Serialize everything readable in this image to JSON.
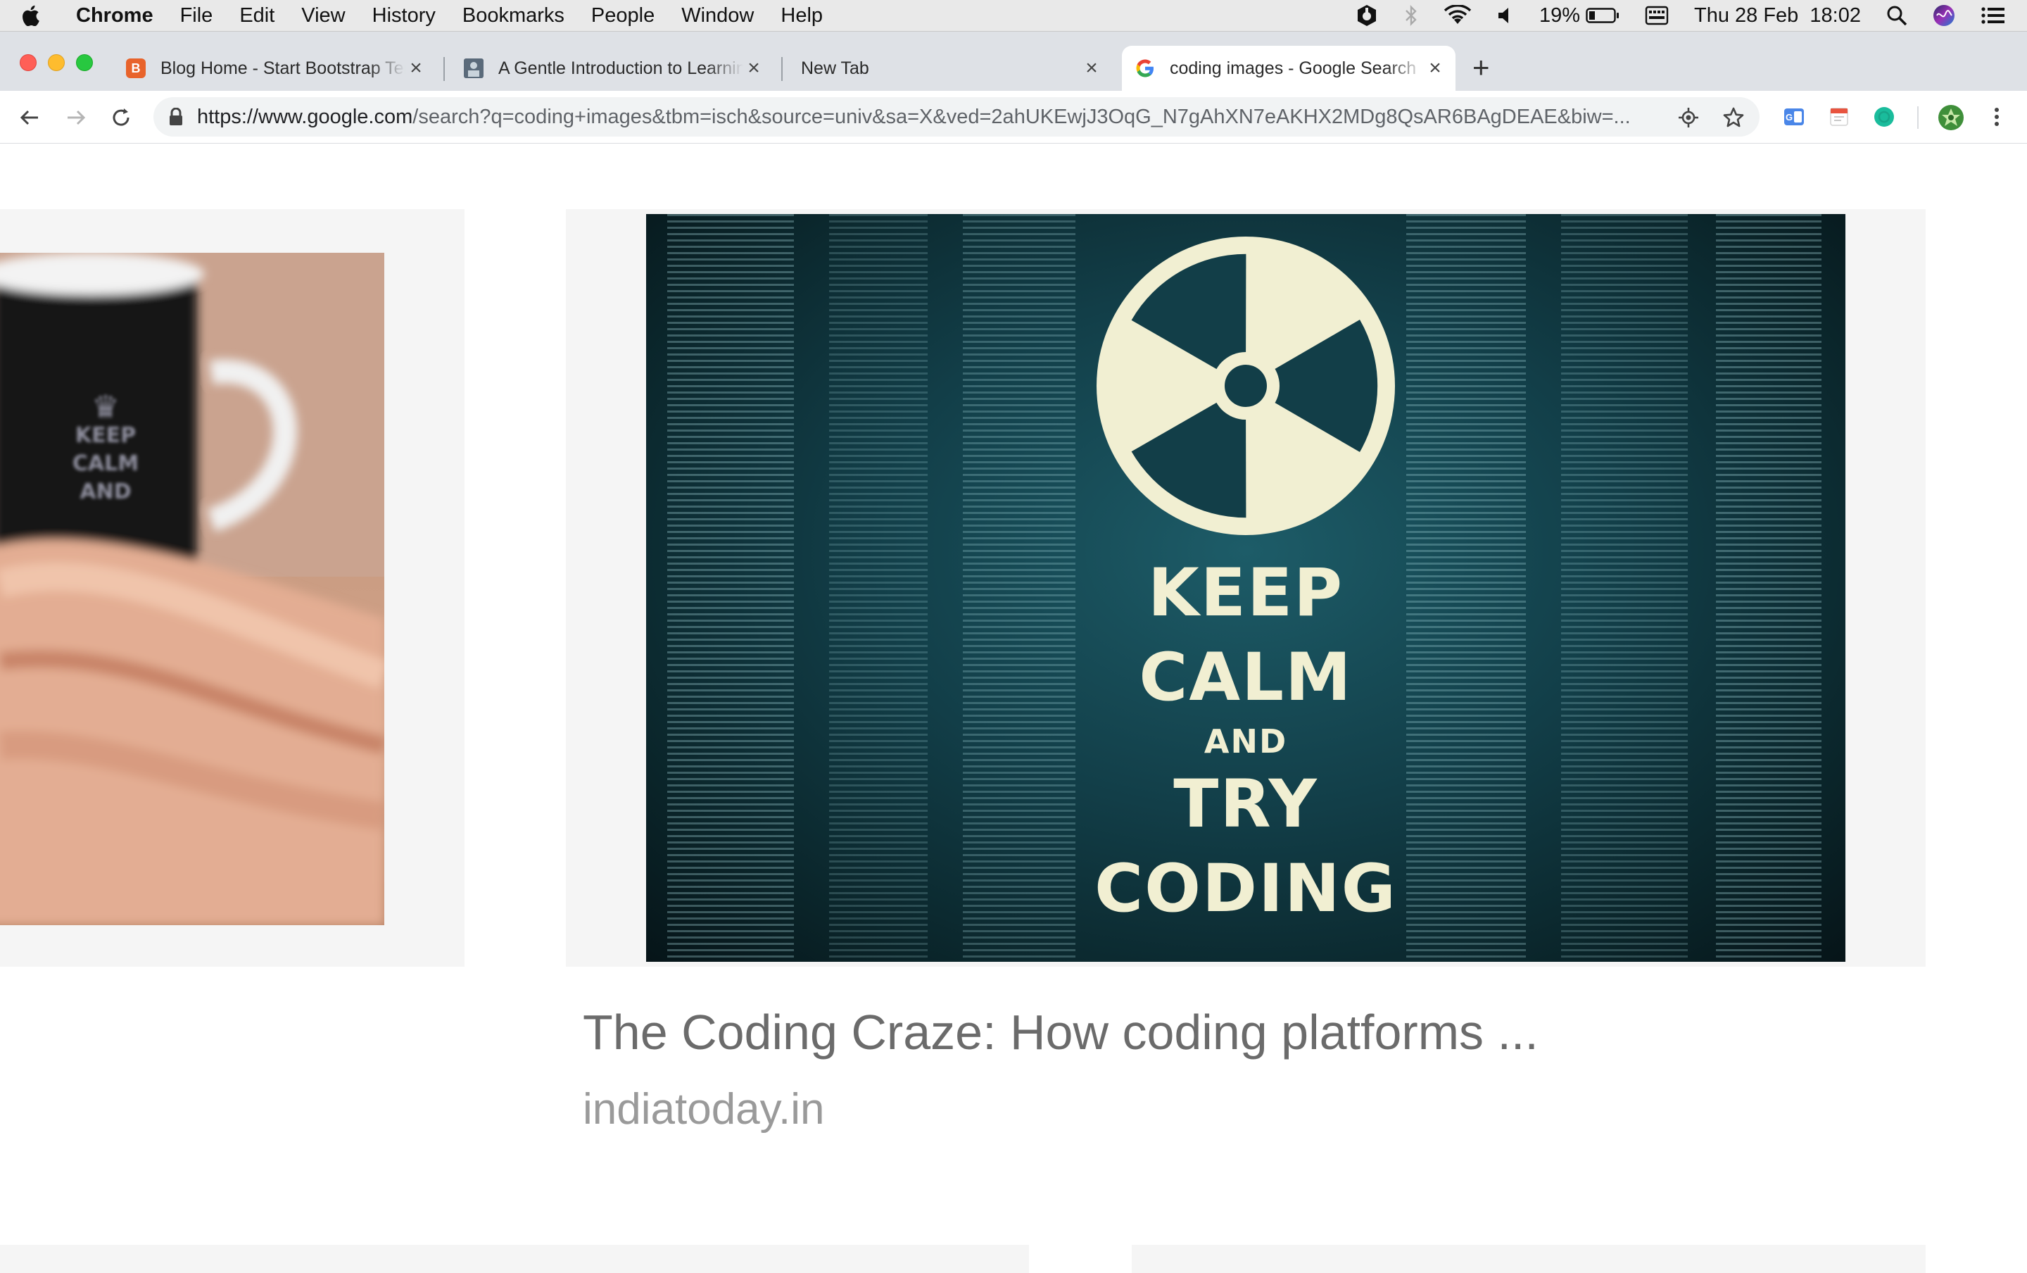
{
  "menubar": {
    "apple_icon": "apple-logo",
    "items": [
      "Chrome",
      "File",
      "Edit",
      "View",
      "History",
      "Bookmarks",
      "People",
      "Window",
      "Help"
    ],
    "battery_percent": "19%",
    "datetime": "Thu 28 Feb  18:02",
    "status_icons": [
      "malwarebytes-icon",
      "bluetooth-icon",
      "wifi-icon",
      "volume-icon",
      "battery-icon",
      "keyboard-icon",
      "search-icon",
      "siri-icon",
      "notification-center-icon"
    ]
  },
  "tabs": [
    {
      "title": "Blog Home - Start Bootstrap Template",
      "favicon": "bootstrap-icon",
      "active": false
    },
    {
      "title": "A Gentle Introduction to Learning",
      "favicon": "image-favicon",
      "active": false
    },
    {
      "title": "New Tab",
      "favicon": "",
      "active": false
    },
    {
      "title": "coding images - Google Search",
      "favicon": "google-g-icon",
      "active": true
    }
  ],
  "newtab_label": "+",
  "toolbar": {
    "url_host": "https://www.google.com",
    "url_path": "/search?q=coding+images&tbm=isch&source=univ&sa=X&ved=2ahUKEwjJ3OqG_N7gAhXN7eAKHX2MDg8QsAR6BAgDEAE&biw=..."
  },
  "result": {
    "title": "The Coding Craze: How coding platforms ...",
    "source": "indiatoday.in",
    "image_text": {
      "line1": "KEEP",
      "line2": "CALM",
      "line3": "AND",
      "line4": "TRY",
      "line5": "CODING"
    },
    "mug_text": [
      "KEEP",
      "CALM",
      "AND"
    ]
  },
  "colors": {
    "tabstrip": "#dee1e6",
    "omnibox": "#f1f3f4",
    "card_bg": "#f5f5f5",
    "poster_teal": "#123e48",
    "poster_text": "#f1efd2"
  }
}
